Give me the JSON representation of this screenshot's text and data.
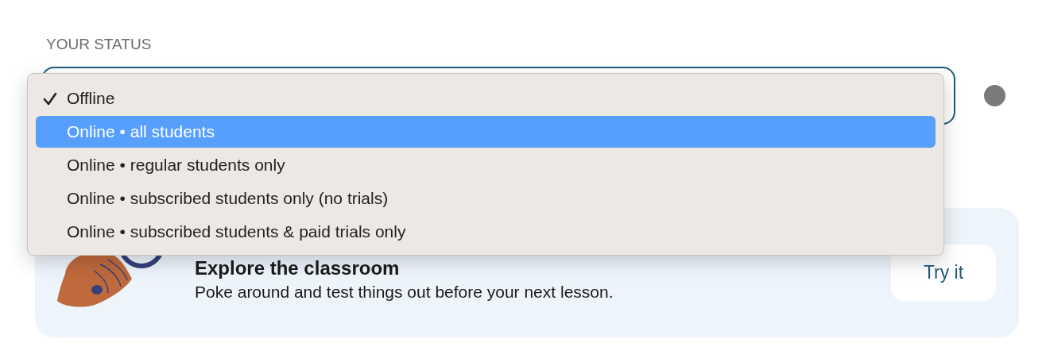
{
  "status": {
    "label": "YOUR STATUS",
    "indicator": {
      "color": "#7a7a7a"
    }
  },
  "menu": {
    "items": [
      {
        "label": "Offline",
        "checked": true,
        "selected": false
      },
      {
        "label": "Online • all students",
        "checked": false,
        "selected": true
      },
      {
        "label": "Online • regular students only",
        "checked": false,
        "selected": false
      },
      {
        "label": "Online • subscribed students only (no trials)",
        "checked": false,
        "selected": false
      },
      {
        "label": "Online • subscribed students & paid trials only",
        "checked": false,
        "selected": false
      }
    ]
  },
  "promo": {
    "title": "Explore the classroom",
    "description": "Poke around and test things out before your next lesson.",
    "button": "Try it"
  }
}
